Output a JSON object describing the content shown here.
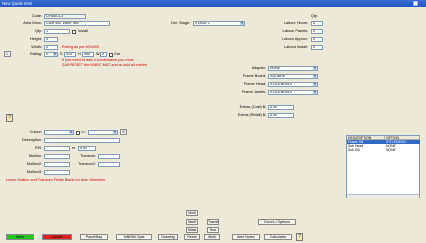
{
  "window": {
    "title": "New Quote Item"
  },
  "left": {
    "code_label": "Code:",
    "code_value": "CF400-1-1",
    "area_desc_label": "Area Desc:",
    "area_desc_value": "CDM 400 1WAY WB",
    "qty_label": "Qty:",
    "qty_value": "1",
    "install_label": "Install",
    "height_label": "Height:",
    "height_value": "0",
    "width_label": "Width:",
    "width_value": "0",
    "rating_label": "Rating:",
    "rating_value": "S",
    "rating_height": "410",
    "rating_h_label": "H",
    "rating_width": "490",
    "rating_w_label": "W",
    "rating_z": "0",
    "rating_z_label": "Cal",
    "l_button": "L",
    "rating_note": "Rating as per AS4000",
    "warning_line1": "If you need to add a combination you must",
    "warning_line2": "ZAP/RESET the MARC MAT and re-add all entries"
  },
  "mid": {
    "del_stage_label": "Del. Stage:",
    "del_stage_value": "STAGE 1"
  },
  "right": {
    "qty_header": "Qty:",
    "labour_hours_label": "Labour Hours:",
    "labour_hours_value": "0",
    "labour_panels_label": "Labour Panels:",
    "labour_panels_value": "0",
    "labour_approv_label": "Labour Approv:",
    "labour_approv_value": "0",
    "labour_install_label": "Labour Install:",
    "labour_install_value": "0",
    "adapter_label": "Adapter:",
    "adapter_value": "NONE",
    "frame_board_label": "Frame Board:",
    "frame_board_value": "SQUARE",
    "frame_head_label": "Frame Head:",
    "frame_head_value": "STD-ENS010",
    "frame_jambs_label": "Frame Jambs:",
    "frame_jambs_value": "STD-ENS010",
    "extras_cost_label": "Extras (Cost) $:",
    "extras_cost_value": "0.00",
    "extras_retail_label": "Extras (Retail) $:",
    "extras_retail_value": "0.00"
  },
  "lower": {
    "colour_label": "Colour:",
    "colour_value": "",
    "colour_op": "<>",
    "colour2_value": "",
    "s_button": "S",
    "description_label": "Description:",
    "pb_label": "P/B:",
    "pb_value": "",
    "pb_mult": "m",
    "pb_price": "0.00",
    "mullion_label": "Mullion:",
    "transom_label": "Transom:",
    "mullion2_label": "Mullion2:",
    "transom2_label": "Transom2:",
    "mullion3_label": "Mullion3:",
    "note": "Leave Mullion and Transom Fields Blank for Auto Selection"
  },
  "grid": {
    "headers": [
      "DESCRIPTION",
      "OPTION"
    ],
    "rows": [
      [
        "Frame Sill",
        "STD-ENS010"
      ],
      [
        "Sub Head",
        "NONE"
      ],
      [
        "Sub Sill",
        "NONE"
      ]
    ]
  },
  "buttons": {
    "multi1": "Multi",
    "multi2": "Multi",
    "transfer": "Transf",
    "mask": "Mask",
    "tear": "Tear",
    "doors_options": "Door's / Options",
    "save": "Save",
    "cancel": "Cancel",
    "panel_bay": "Panel/Bay",
    "infill": "Infill/Sill Opts",
    "drawing": "Drawing",
    "reset": "Reset",
    "item_notes": "Item Notes",
    "calculator": "Calculator"
  },
  "colors": {
    "save": "#22c422",
    "cancel": "#e02020",
    "red_text": "#d40000",
    "titlebar": "#2c5fcc"
  }
}
